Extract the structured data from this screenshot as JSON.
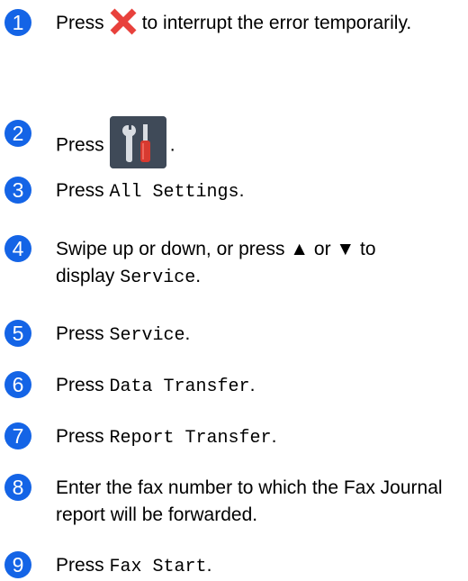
{
  "colors": {
    "badge": "#1464e6",
    "x_icon": "#e8413c",
    "tools_bg": "#3f4a58"
  },
  "steps": [
    {
      "number": "1",
      "pre": "Press",
      "icon": "red-x-icon",
      "post": "to interrupt the error temporarily."
    },
    {
      "number": "2",
      "pre": "Press",
      "icon": "settings-tools-icon",
      "post": "."
    },
    {
      "number": "3",
      "pre": "Press",
      "code": "All Settings",
      "post": "."
    },
    {
      "number": "4",
      "pre": "Swipe up or down, or press ▲ or ▼ to display",
      "code": "Service",
      "post": "."
    },
    {
      "number": "5",
      "pre": "Press",
      "code": "Service",
      "post": "."
    },
    {
      "number": "6",
      "pre": "Press",
      "code": "Data Transfer",
      "post": "."
    },
    {
      "number": "7",
      "pre": "Press",
      "code": "Report Transfer",
      "post": "."
    },
    {
      "number": "8",
      "text": "Enter the fax number to which the Fax Journal report will be forwarded."
    },
    {
      "number": "9",
      "pre": "Press",
      "code": "Fax Start",
      "post": "."
    }
  ]
}
